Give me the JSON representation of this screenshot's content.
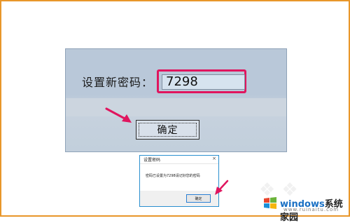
{
  "main_dialog": {
    "prompt_label": "设置新密码：",
    "password_value": "7298",
    "ok_label": "确定"
  },
  "message_dialog": {
    "title": "设置密码",
    "close_glyph": "×",
    "message": "密码已设置为7298请记好您的密码",
    "ok_label": "确定"
  },
  "watermark": {
    "brand_blue": "windows",
    "brand_rest": "系统家园",
    "site": "www.ruinaitu.com"
  },
  "colors": {
    "frame_border": "#e8962a",
    "highlight": "#e0155e",
    "arrow": "#e0155e",
    "dialog_border": "#2a8fcf",
    "brand_blue": "#1a70c4"
  },
  "icons": [
    "arrow-icon",
    "close-icon",
    "windows-logo-icon"
  ]
}
